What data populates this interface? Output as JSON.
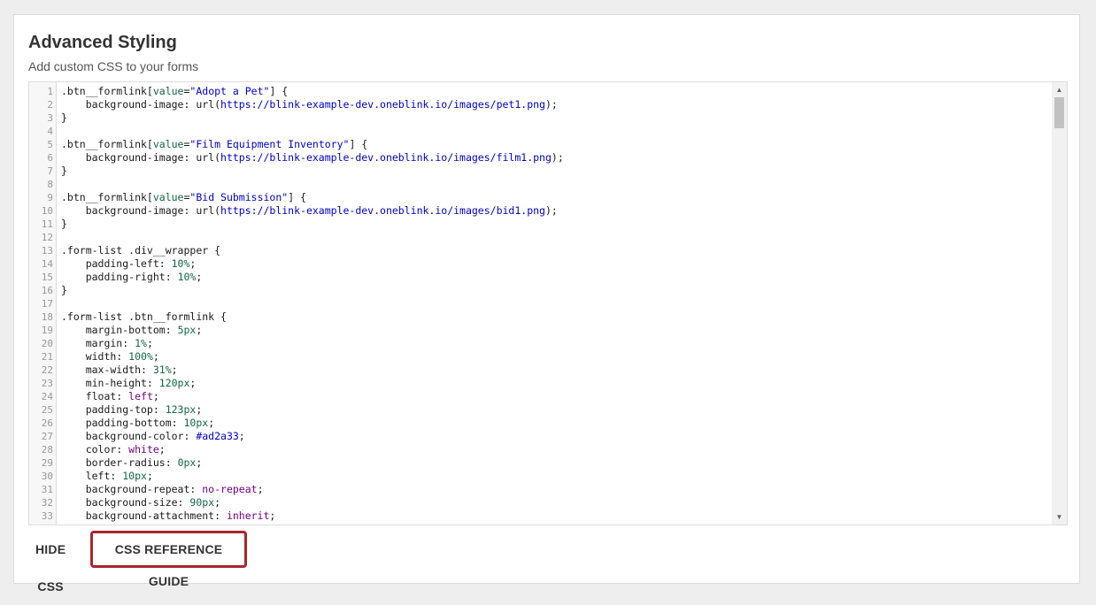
{
  "panel": {
    "title": "Advanced Styling",
    "subtitle": "Add custom CSS to your forms"
  },
  "editor": {
    "lines": [
      {
        "n": "1",
        "segments": [
          {
            "t": ".btn__formlink[",
            "c": "key"
          },
          {
            "t": "value",
            "c": "attr"
          },
          {
            "t": "=",
            "c": "key"
          },
          {
            "t": "\"Adopt a Pet\"",
            "c": "url"
          },
          {
            "t": "] {",
            "c": "key"
          }
        ]
      },
      {
        "n": "2",
        "segments": [
          {
            "t": "    background-image: url(",
            "c": "key"
          },
          {
            "t": "https://blink-example-dev.oneblink.io/images/pet1.png",
            "c": "url"
          },
          {
            "t": ");",
            "c": "key"
          }
        ]
      },
      {
        "n": "3",
        "segments": [
          {
            "t": "}",
            "c": "key"
          }
        ]
      },
      {
        "n": "4",
        "segments": []
      },
      {
        "n": "5",
        "segments": [
          {
            "t": ".btn__formlink[",
            "c": "key"
          },
          {
            "t": "value",
            "c": "attr"
          },
          {
            "t": "=",
            "c": "key"
          },
          {
            "t": "\"Film Equipment Inventory\"",
            "c": "url"
          },
          {
            "t": "] {",
            "c": "key"
          }
        ]
      },
      {
        "n": "6",
        "segments": [
          {
            "t": "    background-image: url(",
            "c": "key"
          },
          {
            "t": "https://blink-example-dev.oneblink.io/images/film1.png",
            "c": "url"
          },
          {
            "t": ");",
            "c": "key"
          }
        ]
      },
      {
        "n": "7",
        "segments": [
          {
            "t": "}",
            "c": "key"
          }
        ]
      },
      {
        "n": "8",
        "segments": []
      },
      {
        "n": "9",
        "segments": [
          {
            "t": ".btn__formlink[",
            "c": "key"
          },
          {
            "t": "value",
            "c": "attr"
          },
          {
            "t": "=",
            "c": "key"
          },
          {
            "t": "\"Bid Submission\"",
            "c": "url"
          },
          {
            "t": "] {",
            "c": "key"
          }
        ]
      },
      {
        "n": "10",
        "segments": [
          {
            "t": "    background-image: url(",
            "c": "key"
          },
          {
            "t": "https://blink-example-dev.oneblink.io/images/bid1.png",
            "c": "url"
          },
          {
            "t": ");",
            "c": "key"
          }
        ]
      },
      {
        "n": "11",
        "segments": [
          {
            "t": "}",
            "c": "key"
          }
        ]
      },
      {
        "n": "12",
        "segments": []
      },
      {
        "n": "13",
        "segments": [
          {
            "t": ".form-list .div__wrapper {",
            "c": "key"
          }
        ]
      },
      {
        "n": "14",
        "segments": [
          {
            "t": "    padding-left: ",
            "c": "key"
          },
          {
            "t": "10%",
            "c": "num"
          },
          {
            "t": ";",
            "c": "key"
          }
        ]
      },
      {
        "n": "15",
        "segments": [
          {
            "t": "    padding-right: ",
            "c": "key"
          },
          {
            "t": "10%",
            "c": "num"
          },
          {
            "t": ";",
            "c": "key"
          }
        ]
      },
      {
        "n": "16",
        "segments": [
          {
            "t": "}",
            "c": "key"
          }
        ]
      },
      {
        "n": "17",
        "segments": []
      },
      {
        "n": "18",
        "segments": [
          {
            "t": ".form-list .btn__formlink {",
            "c": "key"
          }
        ]
      },
      {
        "n": "19",
        "segments": [
          {
            "t": "    margin-bottom: ",
            "c": "key"
          },
          {
            "t": "5px",
            "c": "num"
          },
          {
            "t": ";",
            "c": "key"
          }
        ]
      },
      {
        "n": "20",
        "segments": [
          {
            "t": "    margin: ",
            "c": "key"
          },
          {
            "t": "1%",
            "c": "num"
          },
          {
            "t": ";",
            "c": "key"
          }
        ]
      },
      {
        "n": "21",
        "segments": [
          {
            "t": "    width: ",
            "c": "key"
          },
          {
            "t": "100%",
            "c": "num"
          },
          {
            "t": ";",
            "c": "key"
          }
        ]
      },
      {
        "n": "22",
        "segments": [
          {
            "t": "    max-width: ",
            "c": "key"
          },
          {
            "t": "31%",
            "c": "num"
          },
          {
            "t": ";",
            "c": "key"
          }
        ]
      },
      {
        "n": "23",
        "segments": [
          {
            "t": "    min-height: ",
            "c": "key"
          },
          {
            "t": "120px",
            "c": "num"
          },
          {
            "t": ";",
            "c": "key"
          }
        ]
      },
      {
        "n": "24",
        "segments": [
          {
            "t": "    float: ",
            "c": "key"
          },
          {
            "t": "left",
            "c": "kw"
          },
          {
            "t": ";",
            "c": "key"
          }
        ]
      },
      {
        "n": "25",
        "segments": [
          {
            "t": "    padding-top: ",
            "c": "key"
          },
          {
            "t": "123px",
            "c": "num"
          },
          {
            "t": ";",
            "c": "key"
          }
        ]
      },
      {
        "n": "26",
        "segments": [
          {
            "t": "    padding-bottom: ",
            "c": "key"
          },
          {
            "t": "10px",
            "c": "num"
          },
          {
            "t": ";",
            "c": "key"
          }
        ]
      },
      {
        "n": "27",
        "segments": [
          {
            "t": "    background-color: ",
            "c": "key"
          },
          {
            "t": "#ad2a33",
            "c": "url"
          },
          {
            "t": ";",
            "c": "key"
          }
        ]
      },
      {
        "n": "28",
        "segments": [
          {
            "t": "    color: ",
            "c": "key"
          },
          {
            "t": "white",
            "c": "kw"
          },
          {
            "t": ";",
            "c": "key"
          }
        ]
      },
      {
        "n": "29",
        "segments": [
          {
            "t": "    border-radius: ",
            "c": "key"
          },
          {
            "t": "0px",
            "c": "num"
          },
          {
            "t": ";",
            "c": "key"
          }
        ]
      },
      {
        "n": "30",
        "segments": [
          {
            "t": "    left: ",
            "c": "key"
          },
          {
            "t": "10px",
            "c": "num"
          },
          {
            "t": ";",
            "c": "key"
          }
        ]
      },
      {
        "n": "31",
        "segments": [
          {
            "t": "    background-repeat: ",
            "c": "key"
          },
          {
            "t": "no-repeat",
            "c": "kw"
          },
          {
            "t": ";",
            "c": "key"
          }
        ]
      },
      {
        "n": "32",
        "segments": [
          {
            "t": "    background-size: ",
            "c": "key"
          },
          {
            "t": "90px",
            "c": "num"
          },
          {
            "t": ";",
            "c": "key"
          }
        ]
      },
      {
        "n": "33",
        "segments": [
          {
            "t": "    background-attachment: ",
            "c": "key"
          },
          {
            "t": "inherit",
            "c": "kw"
          },
          {
            "t": ";",
            "c": "key"
          }
        ]
      }
    ],
    "scrollbar": {
      "up_icon": "triangle-up-icon",
      "down_icon": "triangle-down-icon"
    }
  },
  "actions": {
    "hide_css_label": "HIDE CSS",
    "reference_guide_label": "CSS REFERENCE GUIDE"
  },
  "colors": {
    "highlight_border": "#a8262e"
  }
}
